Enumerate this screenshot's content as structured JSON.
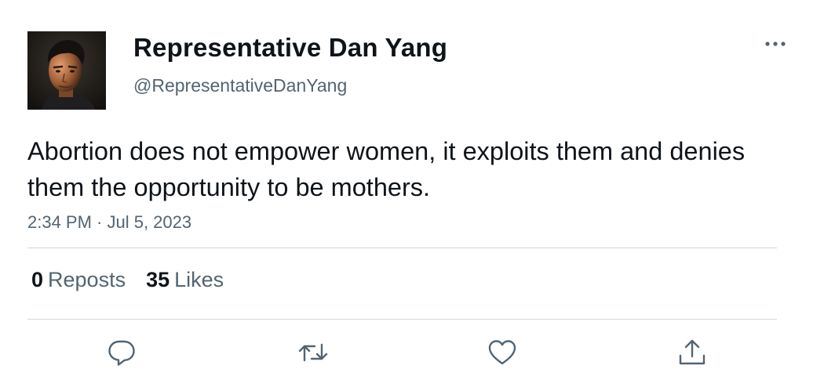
{
  "author": {
    "display_name": "Representative Dan Yang",
    "handle": "@RepresentativeDanYang",
    "avatar_icon": "profile-photo"
  },
  "tweet": {
    "text": "Abortion does not empower women, it exploits them and denies them the opportunity to be mothers.",
    "timestamp": "2:34 PM · Jul 5, 2023"
  },
  "stats": {
    "reposts_count": "0",
    "reposts_label": "Reposts",
    "likes_count": "35",
    "likes_label": "Likes"
  },
  "actions": {
    "reply_icon": "reply-icon",
    "repost_icon": "repost-icon",
    "like_icon": "heart-icon",
    "share_icon": "share-icon",
    "more_icon": "more-icon"
  },
  "colors": {
    "text_primary": "#0f1419",
    "text_secondary": "#536471",
    "divider": "#cfd9de",
    "icon": "#536471"
  }
}
